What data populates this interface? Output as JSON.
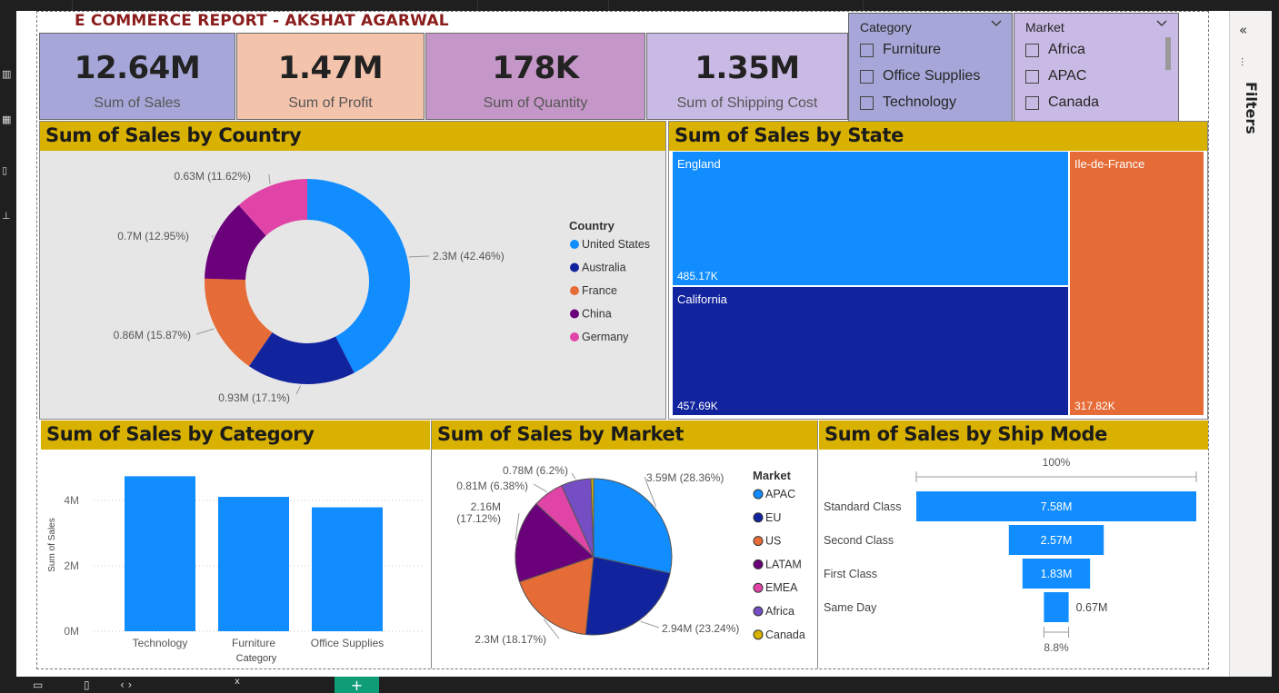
{
  "report_title": "E COMMERCE REPORT - AKSHAT AGARWAL",
  "kpis": [
    {
      "value": "12.64M",
      "label": "Sum of Sales",
      "color": "#a6a7d8"
    },
    {
      "value": "1.47M",
      "label": "Sum of Profit",
      "color": "#f4c3ac"
    },
    {
      "value": "178K",
      "label": "Sum of Quantity",
      "color": "#c597c8"
    },
    {
      "value": "1.35M",
      "label": "Sum of Shipping Cost",
      "color": "#c9bae5"
    }
  ],
  "slicers": {
    "category": {
      "header": "Category",
      "items": [
        "Furniture",
        "Office Supplies",
        "Technology"
      ],
      "color": "#a6a7d8"
    },
    "market": {
      "header": "Market",
      "items": [
        "Africa",
        "APAC",
        "Canada"
      ],
      "color": "#c9bae5"
    }
  },
  "filters_label": "Filters",
  "colors": {
    "blue": "#118dff",
    "navy": "#12239e",
    "orange": "#e66c37",
    "purple": "#6b007b",
    "pink": "#e044a7",
    "violet": "#744ec2",
    "gold": "#d9b300",
    "header": "#d9b100"
  },
  "chart_data": [
    {
      "type": "pie",
      "variant": "donut",
      "title": "Sum of Sales by Country",
      "legend_title": "Country",
      "legend_position": "right",
      "categories": [
        "United States",
        "Australia",
        "France",
        "China",
        "Germany"
      ],
      "values": [
        2.3,
        0.93,
        0.86,
        0.7,
        0.63
      ],
      "percents": [
        42.46,
        17.1,
        15.87,
        12.95,
        11.62
      ],
      "data_labels": [
        "2.3M (42.46%)",
        "0.93M (17.1%)",
        "0.86M (15.87%)",
        "0.7M (12.95%)",
        "0.63M (11.62%)"
      ],
      "unit": "M",
      "colors": [
        "#118dff",
        "#12239e",
        "#e66c37",
        "#6b007b",
        "#e044a7"
      ]
    },
    {
      "type": "treemap",
      "title": "Sum of Sales by State",
      "categories": [
        "England",
        "California",
        "Ile-de-France"
      ],
      "values": [
        485.17,
        457.69,
        317.82
      ],
      "value_labels": [
        "485.17K",
        "457.69K",
        "317.82K"
      ],
      "unit": "K",
      "colors": [
        "#118dff",
        "#12239e",
        "#e66c37"
      ]
    },
    {
      "type": "bar",
      "title": "Sum of Sales by Category",
      "categories": [
        "Technology",
        "Furniture",
        "Office Supplies"
      ],
      "values": [
        4.74,
        4.11,
        3.79
      ],
      "xlabel": "Category",
      "ylabel": "Sum of Sales",
      "ylim": [
        0,
        5
      ],
      "yticks": [
        0,
        2,
        4
      ],
      "ytick_labels": [
        "0M",
        "2M",
        "4M"
      ],
      "grid": true,
      "color": "#118dff"
    },
    {
      "type": "pie",
      "title": "Sum of Sales by Market",
      "legend_title": "Market",
      "legend_position": "right",
      "categories": [
        "APAC",
        "EU",
        "US",
        "LATAM",
        "EMEA",
        "Africa",
        "Canada"
      ],
      "values": [
        3.59,
        2.94,
        2.3,
        2.16,
        0.81,
        0.78,
        0.07
      ],
      "percents": [
        28.36,
        23.24,
        18.17,
        17.12,
        6.38,
        6.2,
        0.53
      ],
      "data_labels": [
        "3.59M (28.36%)",
        "2.94M (23.24%)",
        "2.3M (18.17%)",
        "2.16M (17.12%)",
        "0.81M (6.38%)",
        "0.78M (6.2%)",
        ""
      ],
      "unit": "M",
      "colors": [
        "#118dff",
        "#12239e",
        "#e66c37",
        "#6b007b",
        "#e044a7",
        "#744ec2",
        "#d9b300"
      ]
    },
    {
      "type": "funnel",
      "title": "Sum of Sales by Ship Mode",
      "categories": [
        "Standard Class",
        "Second Class",
        "First Class",
        "Same Day"
      ],
      "values": [
        7.58,
        2.57,
        1.83,
        0.67
      ],
      "value_labels": [
        "7.58M",
        "2.57M",
        "1.83M",
        "0.67M"
      ],
      "top_percent": "100%",
      "bottom_percent": "8.8%",
      "color": "#118dff"
    }
  ]
}
